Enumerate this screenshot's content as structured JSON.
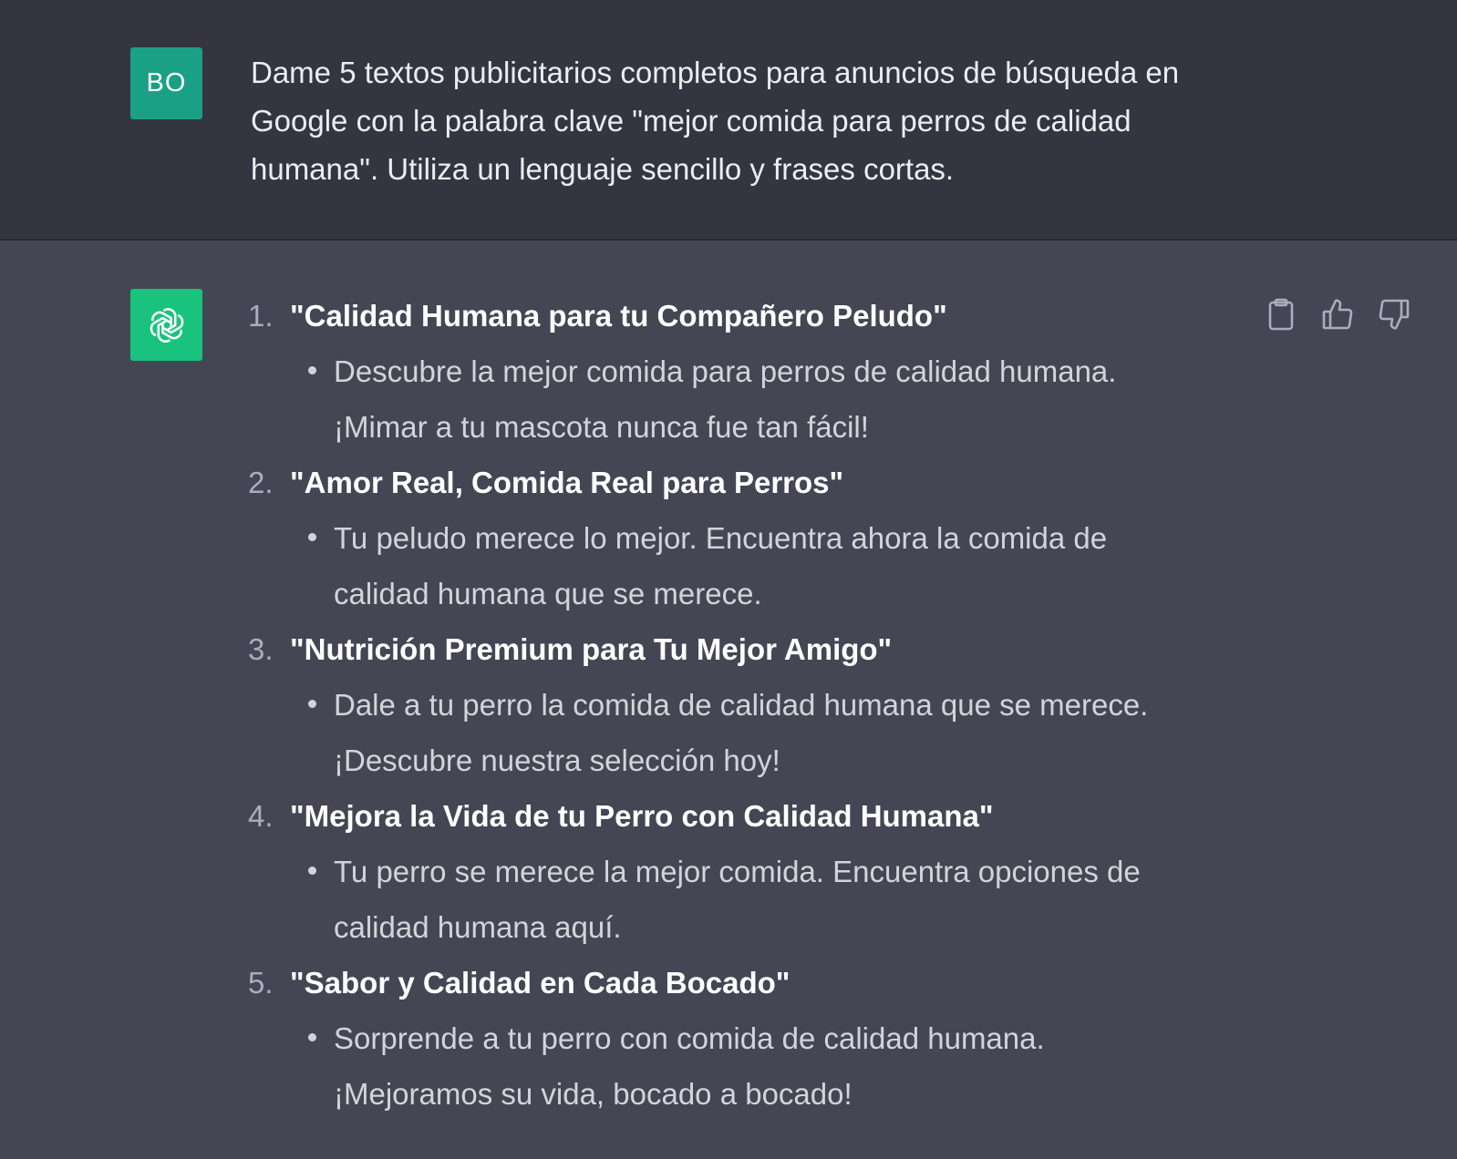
{
  "user_message": {
    "avatar_initials": "BO",
    "text": "Dame 5 textos publicitarios completos para anuncios de búsqueda en Google con la palabra clave \"mejor comida para perros de calidad humana\". Utiliza un lenguaje sencillo y frases cortas."
  },
  "assistant_message": {
    "avatar_icon": "openai-logo-icon",
    "actions": [
      {
        "name": "copy-button",
        "icon": "clipboard-icon"
      },
      {
        "name": "thumbs-up-button",
        "icon": "thumbs-up-icon"
      },
      {
        "name": "thumbs-down-button",
        "icon": "thumbs-down-icon"
      }
    ],
    "items": [
      {
        "number": "1.",
        "title": "\"Calidad Humana para tu Compañero Peludo\"",
        "text": "Descubre la mejor comida para perros de calidad humana. ¡Mimar a tu mascota nunca fue tan fácil!"
      },
      {
        "number": "2.",
        "title": "\"Amor Real, Comida Real para Perros\"",
        "text": "Tu peludo merece lo mejor. Encuentra ahora la comida de calidad humana que se merece."
      },
      {
        "number": "3.",
        "title": "\"Nutrición Premium para Tu Mejor Amigo\"",
        "text": "Dale a tu perro la comida de calidad humana que se merece. ¡Descubre nuestra selección hoy!"
      },
      {
        "number": "4.",
        "title": "\"Mejora la Vida de tu Perro con Calidad Humana\"",
        "text": "Tu perro se merece la mejor comida. Encuentra opciones de calidad humana aquí."
      },
      {
        "number": "5.",
        "title": "\"Sabor y Calidad en Cada Bocado\"",
        "text": "Sorprende a tu perro con comida de calidad humana. ¡Mejoramos su vida, bocado a bocado!"
      }
    ]
  },
  "colors": {
    "user_bg": "#343541",
    "assistant_bg": "#444654",
    "user_avatar": "#1aa085",
    "bot_avatar": "#19c37d"
  }
}
